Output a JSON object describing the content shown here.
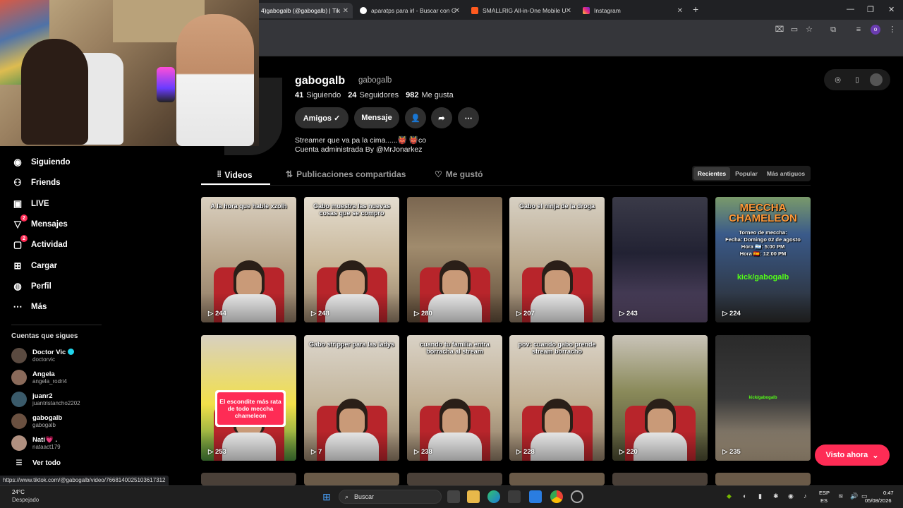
{
  "browser": {
    "tabs": [
      {
        "label": "4)gabogalb (@gabogalb) | Tik",
        "icon": "tiktok-icon"
      },
      {
        "label": "aparatps para irl - Buscar con G",
        "icon": "google-icon"
      },
      {
        "label": "SMALLRIG All-in-One Mobile U",
        "icon": "smallrig-icon"
      },
      {
        "label": "Instagram",
        "icon": "instagram-icon"
      }
    ],
    "status_url": "https://www.tiktok.com/@gabogalb/video/7668140025103617312"
  },
  "profile": {
    "username": "gabogalb",
    "handle": "gabogalb",
    "stats": {
      "following_count": "41",
      "following_label": "Siguiendo",
      "followers_count": "24",
      "followers_label": "Seguidores",
      "likes_count": "982",
      "likes_label": "Me gusta"
    },
    "buttons": {
      "friends": "Amigos ✓",
      "message": "Mensaje"
    },
    "bio_line1": "Streamer que va pa la cima......👹 👹co",
    "bio_line2": "Cuenta administrada By @MrJonarkez",
    "tabs": {
      "videos": "Videos",
      "shared": "Publicaciones compartidas",
      "liked": "Me gustó"
    },
    "sort": {
      "recent": "Recientes",
      "popular": "Popular",
      "oldest": "Más antiguos"
    }
  },
  "sidebar": {
    "items": [
      {
        "label": "Siguiendo",
        "icon": "following-icon"
      },
      {
        "label": "Friends",
        "icon": "friends-icon"
      },
      {
        "label": "LIVE",
        "icon": "live-icon"
      },
      {
        "label": "Mensajes",
        "icon": "messages-icon",
        "badge": "2"
      },
      {
        "label": "Actividad",
        "icon": "activity-icon",
        "badge": "2"
      },
      {
        "label": "Cargar",
        "icon": "upload-icon"
      },
      {
        "label": "Perfil",
        "icon": "profile-icon"
      },
      {
        "label": "Más",
        "icon": "more-icon"
      }
    ],
    "follows_title": "Cuentas que sigues",
    "follows": [
      {
        "name": "Doctor Vic",
        "handle": "doctorvic",
        "verified": true,
        "color": "#5a4a40"
      },
      {
        "name": "Angela",
        "handle": "angela_rodri4",
        "color": "#8a6a5a"
      },
      {
        "name": "juanr2",
        "handle": "juantristancho2202",
        "color": "#3a5a6a"
      },
      {
        "name": "gabogalb",
        "handle": "gabogalb",
        "color": "#6a5040"
      },
      {
        "name": "Nati💗 .",
        "handle": "nataact179",
        "color": "#b09080"
      }
    ],
    "see_all": "Ver todo"
  },
  "videos": [
    {
      "caption": "A la hora que hable xzolh",
      "views": "244"
    },
    {
      "caption": "Gabo muestra las nuevas cosas que se compro",
      "views": "248"
    },
    {
      "caption": "",
      "views": "280"
    },
    {
      "caption": "Gabo el ninja de la droga",
      "views": "207"
    },
    {
      "caption": "",
      "views": "243"
    },
    {
      "caption": "MECCHA CHAMELEON",
      "overlay": "Torneo de meccha:\nFecha: Domingo 02 de agosto\nHora 🇦🇷: 5:00 PM\nHora 🇪🇸: 12:00 PM",
      "kick": "kick/gabogalb",
      "views": "224"
    },
    {
      "caption": "",
      "promo": "El escondite más rata de todo meccha chameleon",
      "views": "253"
    },
    {
      "caption": "Gabo stripper para las ladys",
      "views": "7"
    },
    {
      "caption": "cuando tu familia entra borracha al stream",
      "views": "238"
    },
    {
      "caption": "pov: cuando gabo prende stream borracho",
      "views": "228"
    },
    {
      "caption": "",
      "views": "220"
    },
    {
      "caption": "",
      "kick": "kick/gabogalb",
      "views": "235"
    }
  ],
  "watched_now": "Visto ahora",
  "taskbar": {
    "temp": "24°C",
    "weather": "Despejado",
    "search": "Buscar",
    "lang1": "ESP",
    "lang2": "ES",
    "time": "0:47",
    "date": "05/08/2026"
  },
  "colors": {
    "accent": "#fe2c55",
    "kick": "#53fc18",
    "verified": "#20d5ec"
  }
}
